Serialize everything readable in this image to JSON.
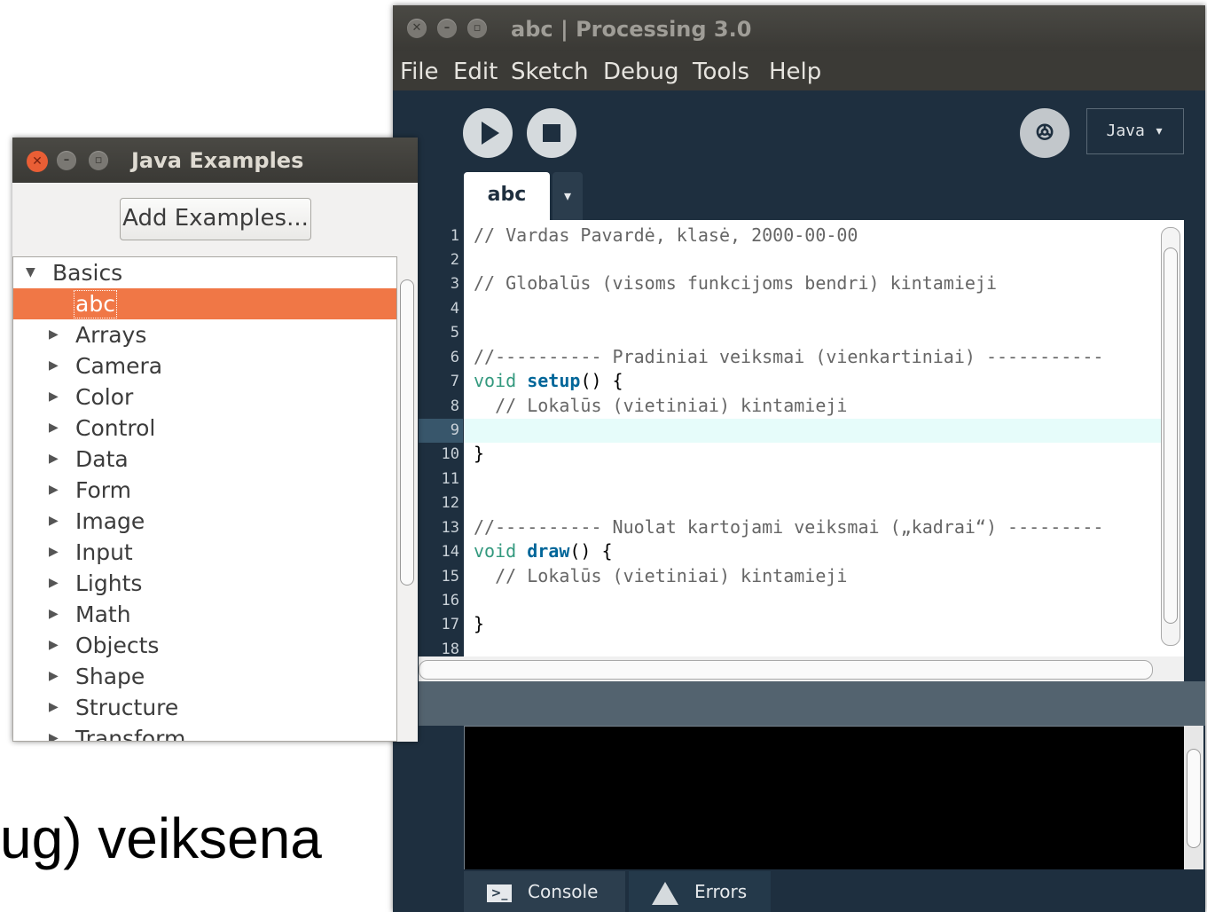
{
  "background_text": "ug) veiksena",
  "processing": {
    "title": "abc | Processing 3.0",
    "menu": [
      {
        "label": "File"
      },
      {
        "label": "Edit"
      },
      {
        "label": "Sketch"
      },
      {
        "label": "Debug"
      },
      {
        "label": "Tools"
      },
      {
        "label": "Help"
      }
    ],
    "debug_glyph": "ꔮ",
    "mode": "Java ▾",
    "tab": "abc",
    "tab_menu": "▾",
    "line_numbers": [
      "1",
      "2",
      "3",
      "4",
      "5",
      "6",
      "7",
      "8",
      "9",
      "10",
      "11",
      "12",
      "13",
      "14",
      "15",
      "16",
      "17",
      "18"
    ],
    "current_line": 9,
    "code": {
      "l1": "// Vardas Pavardė, klasė, 2000-00-00",
      "l3": "// Globalūs (visoms funkcijoms bendri) kintamieji",
      "l6": "//---------- Pradiniai veiksmai (vienkartiniai) -----------",
      "l7_kw": "void",
      "l7_fn": "setup",
      "l7_rest": "() {",
      "l8": "  // Lokalūs (vietiniai) kintamieji",
      "l10": "}",
      "l13": "//---------- Nuolat kartojami veiksmai („kadrai“) ---------",
      "l14_kw": "void",
      "l14_fn": "draw",
      "l14_rest": "() {",
      "l15": "  // Lokalūs (vietiniai) kintamieji",
      "l17": "}"
    },
    "footer": {
      "console_label": "Console",
      "errors_label": "Errors"
    }
  },
  "examples": {
    "title": "Java Examples",
    "add_button": "Add Examples...",
    "root": "Basics",
    "selected": "abc",
    "items": [
      "Arrays",
      "Camera",
      "Color",
      "Control",
      "Data",
      "Form",
      "Image",
      "Input",
      "Lights",
      "Math",
      "Objects",
      "Shape",
      "Structure",
      "Transform"
    ]
  }
}
